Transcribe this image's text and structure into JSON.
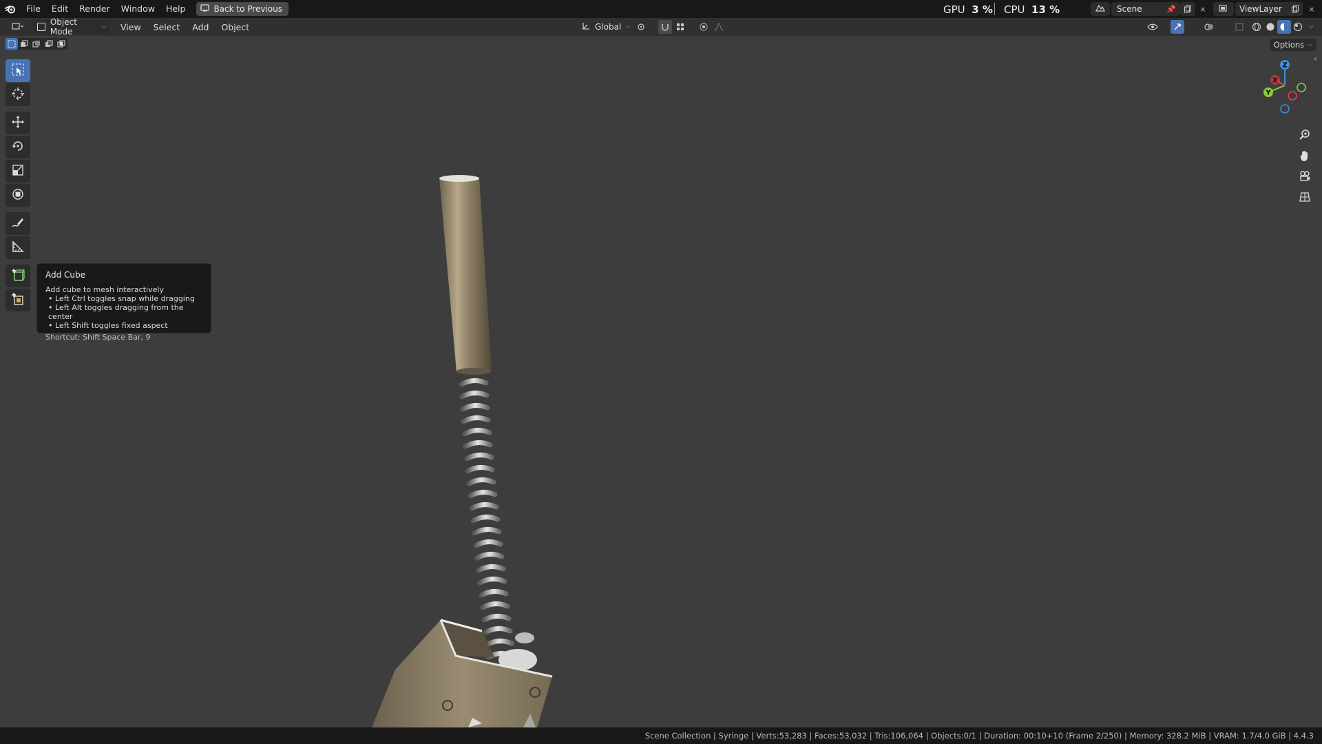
{
  "menu": {
    "items": [
      "File",
      "Edit",
      "Render",
      "Window",
      "Help"
    ],
    "back_button": "Back to Previous"
  },
  "stats": {
    "gpu_label": "GPU",
    "gpu_value": "3 %",
    "cpu_label": "CPU",
    "cpu_value": "13 %"
  },
  "scene": {
    "name": "Scene"
  },
  "view_layer": {
    "name": "ViewLayer"
  },
  "viewport_header": {
    "mode": "Object Mode",
    "menus": [
      "View",
      "Select",
      "Add",
      "Object"
    ],
    "transform_orientation": "Global",
    "options_label": "Options"
  },
  "toolbar": {
    "tools": [
      {
        "name": "select-box",
        "icon": "select-box-icon",
        "active": true
      },
      {
        "name": "cursor",
        "icon": "cursor-icon",
        "active": false
      },
      {
        "name": "move",
        "icon": "move-icon",
        "active": false
      },
      {
        "name": "rotate",
        "icon": "rotate-icon",
        "active": false
      },
      {
        "name": "scale",
        "icon": "scale-icon",
        "active": false
      },
      {
        "name": "transform",
        "icon": "transform-icon",
        "active": false
      },
      {
        "name": "annotate",
        "icon": "annotate-icon",
        "active": false
      },
      {
        "name": "measure",
        "icon": "measure-icon",
        "active": false
      },
      {
        "name": "add-cube",
        "icon": "add-cube-icon",
        "active": false
      },
      {
        "name": "add-cube-alt",
        "icon": "add-cube-alt-icon",
        "active": false
      }
    ]
  },
  "tooltip": {
    "title": "Add Cube",
    "description": "Add cube to mesh interactively",
    "bullets": [
      "Left Ctrl toggles snap while dragging",
      "Left Alt toggles dragging from the center",
      "Left Shift toggles fixed aspect"
    ],
    "shortcut": "Shortcut: Shift Space Bar, 9"
  },
  "gizmo": {
    "x_label": "X",
    "y_label": "Y",
    "z_label": "Z"
  },
  "status_bar": {
    "text": "Scene Collection | Syringe | Verts:53,283 | Faces:53,032 | Tris:106,064 | Objects:0/1 | Duration: 00:10+10 (Frame 2/250) | Memory: 328.2 MiB | VRAM: 1.7/4.0 GiB | 4.4.3"
  },
  "colors": {
    "accent": "#4772b3",
    "viewport_bg": "#3d3d3d",
    "header_bg": "#303030",
    "topbar_bg": "#181818",
    "axis_x": "#e0424b",
    "axis_y": "#8bcc35",
    "axis_z": "#3e8ce0"
  }
}
